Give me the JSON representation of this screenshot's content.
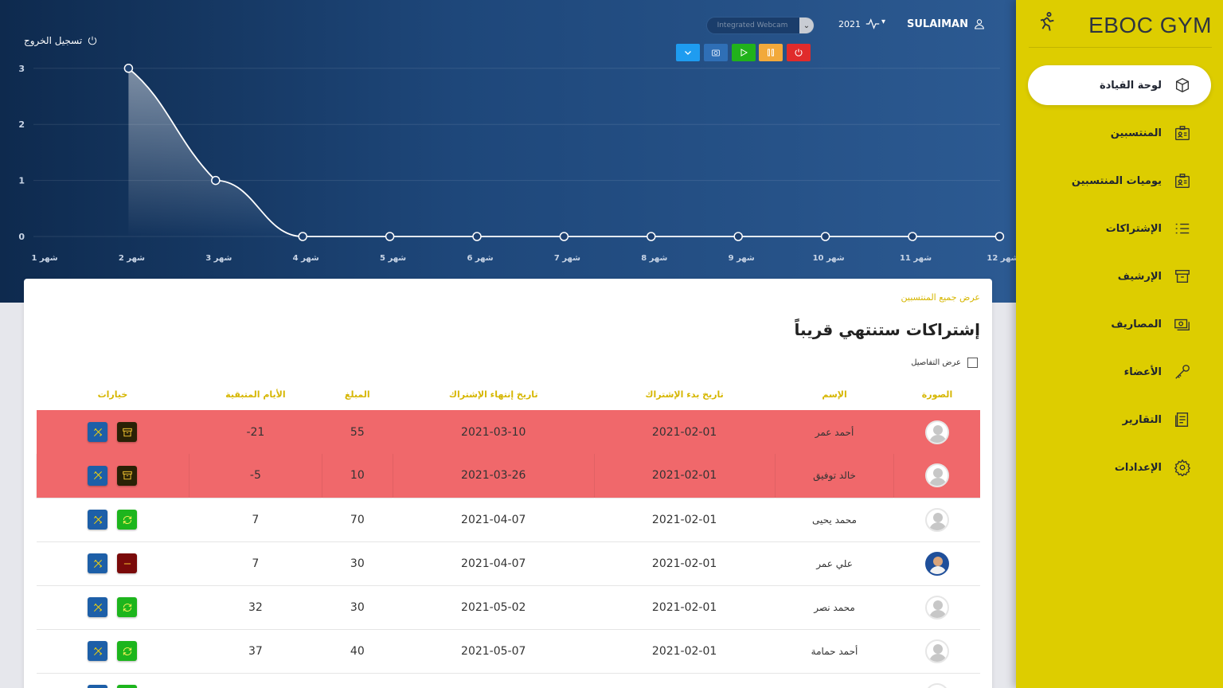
{
  "brand": {
    "name": "EBOC GYM",
    "icon": "runner-icon"
  },
  "sidebar": {
    "items": [
      {
        "label": "لوحة القيادة",
        "icon": "cube-icon",
        "active": true
      },
      {
        "label": "المنتسبين",
        "icon": "id-card-icon"
      },
      {
        "label": "يوميات المنتسبين",
        "icon": "id-card-icon"
      },
      {
        "label": "الإشتراكات",
        "icon": "list-icon"
      },
      {
        "label": "الإرشيف",
        "icon": "archive-icon"
      },
      {
        "label": "المصاريف",
        "icon": "money-icon"
      },
      {
        "label": "الأعضاء",
        "icon": "key-icon"
      },
      {
        "label": "التقارير",
        "icon": "report-icon"
      },
      {
        "label": "الإعدادات",
        "icon": "gear-icon"
      }
    ]
  },
  "header": {
    "user": "SULAIMAN",
    "year": "2021",
    "webcam_placeholder": "Integrated Webcam",
    "logout": "تسجيل الخروج",
    "controls": [
      {
        "name": "dropdown-button",
        "color": "#1e9cf0"
      },
      {
        "name": "snapshot-button",
        "color": "#2f6fb6"
      },
      {
        "name": "play-button",
        "color": "#21b21b"
      },
      {
        "name": "pause-button",
        "color": "#f2a93b"
      },
      {
        "name": "stop-button",
        "color": "#e02b2b"
      }
    ]
  },
  "chart_data": {
    "type": "line",
    "categories": [
      "شهر 1",
      "شهر 2",
      "شهر 3",
      "شهر 4",
      "شهر 5",
      "شهر 6",
      "شهر 7",
      "شهر 8",
      "شهر 9",
      "شهر 10",
      "شهر 11",
      "شهر 12"
    ],
    "values": [
      null,
      3,
      1,
      0,
      0,
      0,
      0,
      0,
      0,
      0,
      0,
      0
    ],
    "y_ticks": [
      "0",
      "1",
      "2",
      "3"
    ],
    "ylim": [
      0,
      3
    ],
    "grid": true
  },
  "card": {
    "view_all": "عرض جميع المنتسبين",
    "title": "إشتراكات ستنتهي قريباً",
    "details_label": "عرض التفاصيل",
    "columns": {
      "photo": "الصورة",
      "name": "الإسم",
      "start": "تاريخ بدء الإشتراك",
      "end": "تاريخ إنتهاء الإشتراك",
      "amount": "المبلغ",
      "days": "الأيام المتبقية",
      "options": "خيارات"
    },
    "rows": [
      {
        "name": "أحمد عمر",
        "start": "2021-02-01",
        "end": "2021-03-10",
        "amount": "55",
        "days": "-21"
      },
      {
        "name": "خالد توفيق",
        "start": "2021-02-01",
        "end": "2021-03-26",
        "amount": "10",
        "days": "-5"
      },
      {
        "name": "محمد يحيى",
        "start": "2021-02-01",
        "end": "2021-04-07",
        "amount": "70",
        "days": "7"
      },
      {
        "name": "علي عمر",
        "start": "2021-02-01",
        "end": "2021-04-07",
        "amount": "30",
        "days": "7"
      },
      {
        "name": "محمد نصر",
        "start": "2021-02-01",
        "end": "2021-05-02",
        "amount": "30",
        "days": "32"
      },
      {
        "name": "أحمد حمامة",
        "start": "2021-02-01",
        "end": "2021-05-07",
        "amount": "40",
        "days": "37"
      }
    ]
  }
}
